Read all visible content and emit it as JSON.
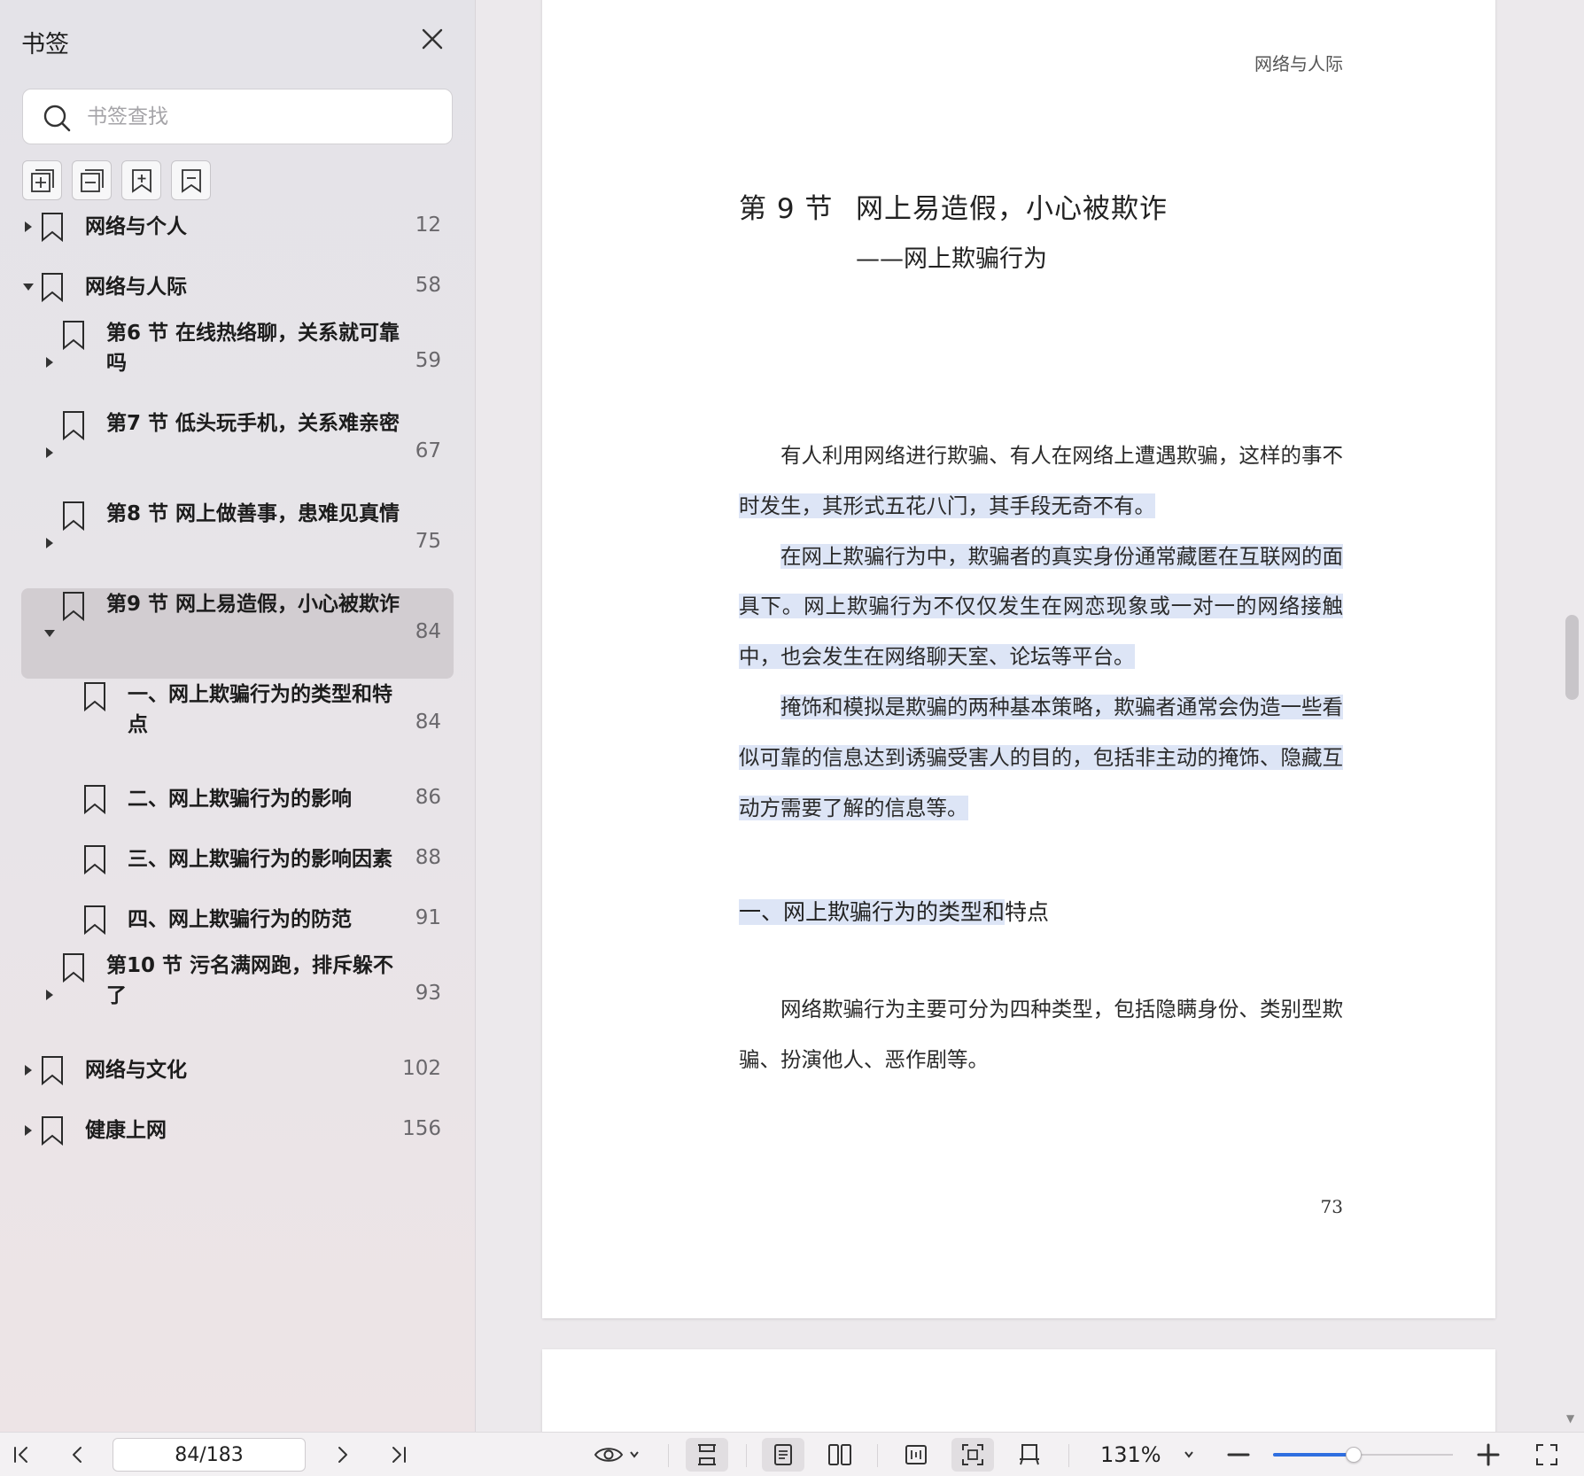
{
  "sidebar": {
    "title": "书签",
    "search_placeholder": "书签查找",
    "tools": [
      {
        "name": "expand-all-icon"
      },
      {
        "name": "collapse-all-icon"
      },
      {
        "name": "add-bookmark-icon"
      },
      {
        "name": "bookmark-icon"
      }
    ],
    "items": [
      {
        "label": "网络与个人",
        "page": "12",
        "level": 0,
        "expander": "collapsed"
      },
      {
        "label": "网络与人际",
        "page": "58",
        "level": 0,
        "expander": "expanded"
      },
      {
        "label": "第6 节 在线热络聊，关系就可靠吗",
        "page": "59",
        "level": 1,
        "expander": "collapsed"
      },
      {
        "label": "第7 节 低头玩手机，关系难亲密",
        "page": "67",
        "level": 1,
        "expander": "collapsed"
      },
      {
        "label": "第8 节 网上做善事，患难见真情",
        "page": "75",
        "level": 1,
        "expander": "collapsed"
      },
      {
        "label": "第9 节 网上易造假，小心被欺诈",
        "page": "84",
        "level": 1,
        "expander": "expanded",
        "selected": true
      },
      {
        "label": "一、网上欺骗行为的类型和特点",
        "page": "84",
        "level": 2,
        "expander": "none"
      },
      {
        "label": "二、网上欺骗行为的影响",
        "page": "86",
        "level": 2,
        "expander": "none"
      },
      {
        "label": "三、网上欺骗行为的影响因素",
        "page": "88",
        "level": 2,
        "expander": "none"
      },
      {
        "label": "四、网上欺骗行为的防范",
        "page": "91",
        "level": 2,
        "expander": "none"
      },
      {
        "label": "第10 节 污名满网跑，排斥躲不了",
        "page": "93",
        "level": 1,
        "expander": "collapsed"
      },
      {
        "label": "网络与文化",
        "page": "102",
        "level": 0,
        "expander": "collapsed"
      },
      {
        "label": "健康上网",
        "page": "156",
        "level": 0,
        "expander": "collapsed"
      }
    ]
  },
  "page": {
    "running_head": "网络与人际",
    "section_no": "第 9 节",
    "section_title": "网上易造假，小心被欺诈",
    "section_subtitle": "——网上欺骗行为",
    "para1_a": "有人利用网络进行欺骗、有人在网络上遭遇欺骗，这样的事不",
    "para1_b": "时发生，其形式五花八门，其手段无奇不有。",
    "para2": "在网上欺骗行为中，欺骗者的真实身份通常藏匿在互联网的面具下。网上欺骗行为不仅仅发生在网恋现象或一对一的网络接触中，也会发生在网络聊天室、论坛等平台。",
    "para3": "掩饰和模拟是欺骗的两种基本策略，欺骗者通常会伪造一些看似可靠的信息达到诱骗受害人的目的，包括非主动的掩饰、隐藏互动方需要了解的信息等。",
    "heading_a": "一、网上欺骗行为的类型和",
    "heading_b": "特点",
    "para4": "网络欺骗行为主要可分为四种类型，包括隐瞒身份、类别型欺骗、扮演他人、恶作剧等。",
    "page_number": "73"
  },
  "statusbar": {
    "page_indicator": "84/183",
    "zoom": "131%",
    "zoom_slider_fraction": 0.45
  },
  "colors": {
    "highlight": "#dde5f6",
    "accent": "#2f6fe0",
    "selected_row": "#d2cdd1"
  }
}
